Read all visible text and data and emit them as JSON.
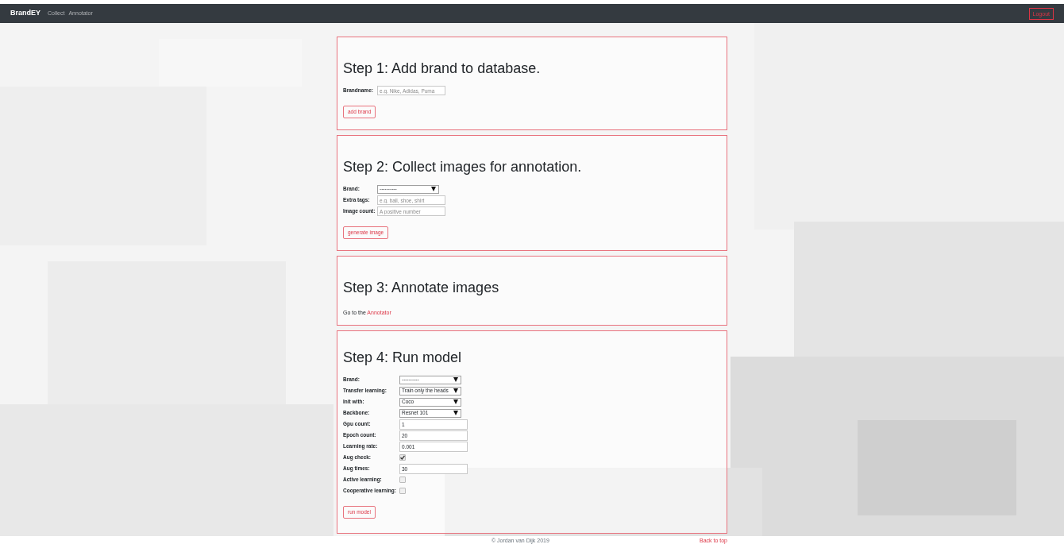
{
  "navbar": {
    "brand": "BrandEY",
    "links": [
      "Collect",
      "Annotator"
    ],
    "logout": "Logout"
  },
  "steps": [
    {
      "title": "Step 1: Add brand to database.",
      "fields": [
        {
          "kind": "text",
          "label": "Brandname:",
          "placeholder": "e.g. Nike, Adidas, Puma"
        }
      ],
      "button": "add brand"
    },
    {
      "title": "Step 2: Collect images for annotation.",
      "fields": [
        {
          "kind": "select",
          "label": "Brand:",
          "value": "----------"
        },
        {
          "kind": "text",
          "label": "Extra tags:",
          "placeholder": "e.g. ball, shoe, shirt"
        },
        {
          "kind": "text",
          "label": "Image count:",
          "placeholder": "A positive number"
        }
      ],
      "button": "generate image"
    },
    {
      "title": "Step 3: Annotate images",
      "text": "Go to the",
      "link": "Annotator"
    },
    {
      "title": "Step 4: Run model",
      "fields": [
        {
          "kind": "select",
          "label": "Brand:",
          "value": "----------"
        },
        {
          "kind": "select",
          "label": "Transfer learning:",
          "value": "Train only the heads"
        },
        {
          "kind": "select",
          "label": "Init with:",
          "value": "Coco"
        },
        {
          "kind": "select",
          "label": "Backbone:",
          "value": "Resnet 101"
        },
        {
          "kind": "text",
          "label": "Gpu count:",
          "value": "1"
        },
        {
          "kind": "text",
          "label": "Epoch count:",
          "value": "20"
        },
        {
          "kind": "text",
          "label": "Learning rate:",
          "value": "0.001"
        },
        {
          "kind": "checkbox",
          "label": "Aug check:",
          "checked": true
        },
        {
          "kind": "text",
          "label": "Aug times:",
          "value": "30"
        },
        {
          "kind": "checkbox",
          "label": "Active learning:",
          "checked": false
        },
        {
          "kind": "checkbox",
          "label": "Cooperative learning:",
          "checked": false
        }
      ],
      "button": "run model"
    }
  ],
  "footer": {
    "copyright": "© Jordan van Dijk 2019",
    "back_to_top": "Back to top"
  }
}
